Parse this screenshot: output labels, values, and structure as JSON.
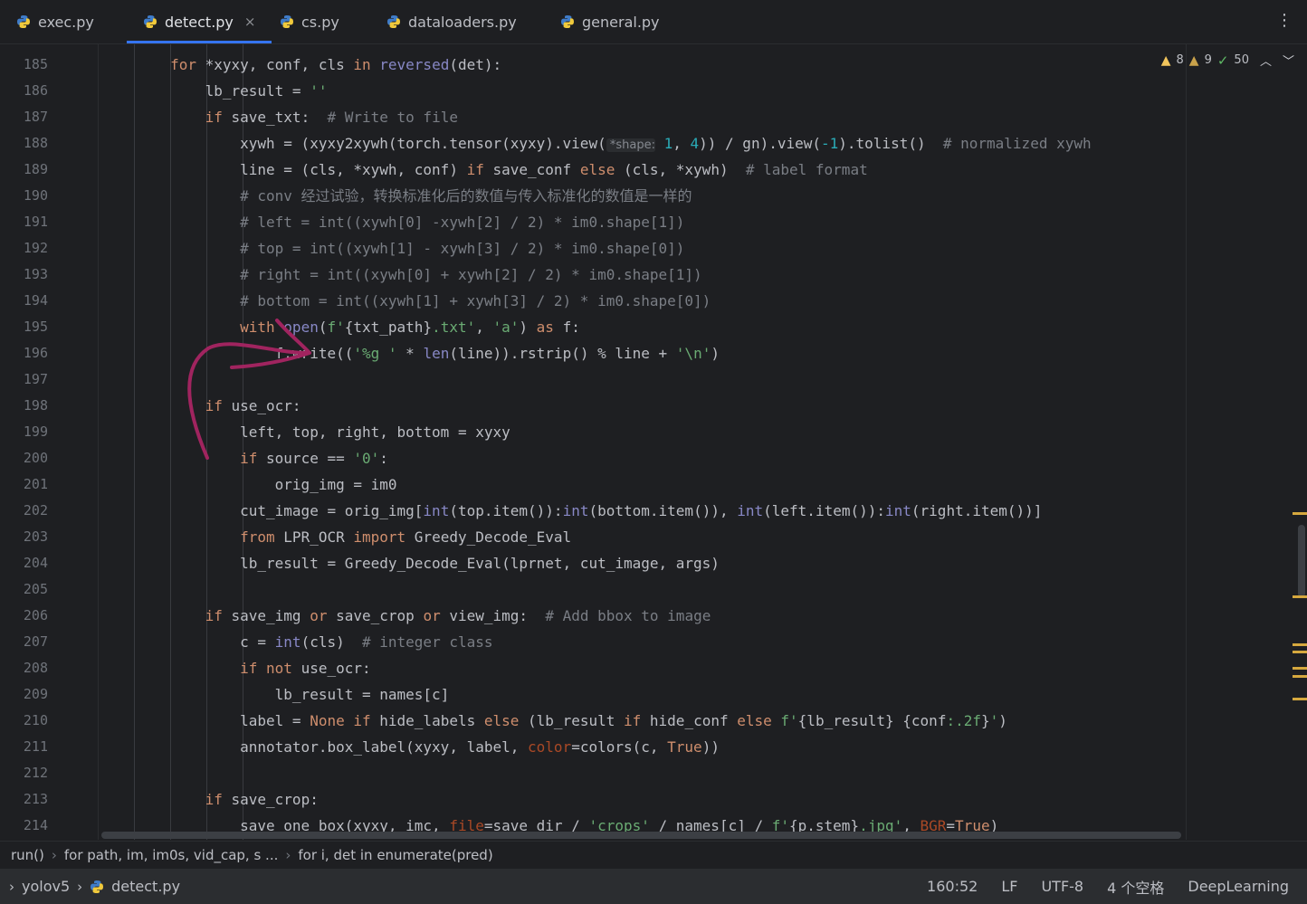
{
  "tabs": [
    {
      "label": "exec.py",
      "active": false,
      "icon": "python-icon"
    },
    {
      "label": "detect.py",
      "active": true,
      "icon": "python-icon",
      "close": "×"
    },
    {
      "label": "cs.py",
      "active": false,
      "icon": "python-icon"
    },
    {
      "label": "dataloaders.py",
      "active": false,
      "icon": "python-icon"
    },
    {
      "label": "general.py",
      "active": false,
      "icon": "python-icon"
    }
  ],
  "more_menu": "⋮",
  "inspections": {
    "warnings": "8",
    "weak_warnings": "9",
    "ok": "50"
  },
  "colors": {
    "keyword": "#cf8e6d",
    "builtin": "#8888c6",
    "string": "#6aab73",
    "comment": "#7a7e85",
    "number": "#2aacb8",
    "param": "#aa4926",
    "accent": "#3574f0",
    "arrow": "#a0245f"
  },
  "editor": {
    "line_numbers": [
      "185",
      "186",
      "187",
      "188",
      "189",
      "190",
      "191",
      "192",
      "193",
      "194",
      "195",
      "196",
      "197",
      "198",
      "199",
      "200",
      "201",
      "202",
      "203",
      "204",
      "205",
      "206",
      "207",
      "208",
      "209",
      "210",
      "211",
      "212",
      "213",
      "214"
    ],
    "lines": [
      [
        {
          "t": "        for ",
          "k": "kw"
        },
        {
          "t": "*xyxy, conf, cls "
        },
        {
          "t": "in ",
          "k": "kw"
        },
        {
          "t": "reversed",
          "k": "bi"
        },
        {
          "t": "(det):"
        }
      ],
      [
        {
          "t": "            lb_result = "
        },
        {
          "t": "''",
          "k": "str"
        }
      ],
      [
        {
          "t": "            if ",
          "k": "kw"
        },
        {
          "t": "save_txt:  "
        },
        {
          "t": "# Write to file",
          "k": "cm"
        }
      ],
      [
        {
          "t": "                xywh = (xyxy2xywh(torch.tensor(xyxy).view("
        },
        {
          "t": " *shape:",
          "k": "hint"
        },
        {
          "t": " "
        },
        {
          "t": "1",
          "k": "num"
        },
        {
          "t": ", "
        },
        {
          "t": "4",
          "k": "num"
        },
        {
          "t": ")) / gn).view("
        },
        {
          "t": "-1",
          "k": "num"
        },
        {
          "t": ").tolist()  "
        },
        {
          "t": "# normalized xywh",
          "k": "cm"
        }
      ],
      [
        {
          "t": "                line = (cls, *xywh, conf) "
        },
        {
          "t": "if ",
          "k": "kw"
        },
        {
          "t": "save_conf "
        },
        {
          "t": "else ",
          "k": "kw"
        },
        {
          "t": "(cls, *xywh)  "
        },
        {
          "t": "# label format",
          "k": "cm"
        }
      ],
      [
        {
          "t": "                # conv 经过试验，转换标准化后的数值与传入标准化的数值是一样的",
          "k": "cm"
        }
      ],
      [
        {
          "t": "                # left = int((xywh[0] -xywh[2] / 2) * im0.shape[1])",
          "k": "cm"
        }
      ],
      [
        {
          "t": "                # top = int((xywh[1] - xywh[3] / 2) * im0.shape[0])",
          "k": "cm"
        }
      ],
      [
        {
          "t": "                # right = int((xywh[0] + xywh[2] / 2) * im0.shape[1])",
          "k": "cm"
        }
      ],
      [
        {
          "t": "                # bottom = int((xywh[1] + xywh[3] / 2) * im0.shape[0])",
          "k": "cm"
        }
      ],
      [
        {
          "t": "                with ",
          "k": "kw"
        },
        {
          "t": "open",
          "k": "bi"
        },
        {
          "t": "("
        },
        {
          "t": "f'",
          "k": "str"
        },
        {
          "t": "{txt_path}"
        },
        {
          "t": ".txt'",
          "k": "str"
        },
        {
          "t": ", "
        },
        {
          "t": "'a'",
          "k": "str"
        },
        {
          "t": ") "
        },
        {
          "t": "as ",
          "k": "kw"
        },
        {
          "t": "f:"
        }
      ],
      [
        {
          "t": "                    f.write(("
        },
        {
          "t": "'%g '",
          "k": "str"
        },
        {
          "t": " * "
        },
        {
          "t": "len",
          "k": "bi"
        },
        {
          "t": "(line)).rstrip() % line + "
        },
        {
          "t": "'\\n'",
          "k": "str"
        },
        {
          "t": ")"
        }
      ],
      [
        {
          "t": ""
        }
      ],
      [
        {
          "t": "            if ",
          "k": "kw"
        },
        {
          "t": "use_ocr:"
        }
      ],
      [
        {
          "t": "                left, top, right, bottom = xyxy"
        }
      ],
      [
        {
          "t": "                if ",
          "k": "kw"
        },
        {
          "t": "source == "
        },
        {
          "t": "'0'",
          "k": "str"
        },
        {
          "t": ":"
        }
      ],
      [
        {
          "t": "                    orig_img = im0"
        }
      ],
      [
        {
          "t": "                cut_image = orig_img["
        },
        {
          "t": "int",
          "k": "bi"
        },
        {
          "t": "(top.item()):"
        },
        {
          "t": "int",
          "k": "bi"
        },
        {
          "t": "(bottom.item()), "
        },
        {
          "t": "int",
          "k": "bi"
        },
        {
          "t": "(left.item()):"
        },
        {
          "t": "int",
          "k": "bi"
        },
        {
          "t": "(right.item())]"
        }
      ],
      [
        {
          "t": "                from ",
          "k": "kw"
        },
        {
          "t": "LPR_OCR "
        },
        {
          "t": "import ",
          "k": "kw"
        },
        {
          "t": "Greedy_Decode_Eval"
        }
      ],
      [
        {
          "t": "                lb_result = Greedy_Decode_Eval(lprnet, cut_image, args)"
        }
      ],
      [
        {
          "t": ""
        }
      ],
      [
        {
          "t": "            if ",
          "k": "kw"
        },
        {
          "t": "save_img "
        },
        {
          "t": "or ",
          "k": "kw"
        },
        {
          "t": "save_crop "
        },
        {
          "t": "or ",
          "k": "kw"
        },
        {
          "t": "view_img:  "
        },
        {
          "t": "# Add bbox to image",
          "k": "cm"
        }
      ],
      [
        {
          "t": "                c = "
        },
        {
          "t": "int",
          "k": "bi"
        },
        {
          "t": "(cls)  "
        },
        {
          "t": "# integer class",
          "k": "cm"
        }
      ],
      [
        {
          "t": "                if not ",
          "k": "kw"
        },
        {
          "t": "use_ocr:"
        }
      ],
      [
        {
          "t": "                    lb_result = names[c]"
        }
      ],
      [
        {
          "t": "                label = "
        },
        {
          "t": "None ",
          "k": "kw"
        },
        {
          "t": "if ",
          "k": "kw"
        },
        {
          "t": "hide_labels "
        },
        {
          "t": "else ",
          "k": "kw"
        },
        {
          "t": "(lb_result "
        },
        {
          "t": "if ",
          "k": "kw"
        },
        {
          "t": "hide_conf "
        },
        {
          "t": "else ",
          "k": "kw"
        },
        {
          "t": "f'",
          "k": "str"
        },
        {
          "t": "{lb_result}"
        },
        {
          "t": " ",
          "k": "str"
        },
        {
          "t": "{conf"
        },
        {
          "t": ":.2f",
          "k": "str"
        },
        {
          "t": "}"
        },
        {
          "t": "'",
          "k": "str"
        },
        {
          "t": ")"
        }
      ],
      [
        {
          "t": "                annotator.box_label(xyxy, label, "
        },
        {
          "t": "color",
          "k": "param"
        },
        {
          "t": "=colors(c, "
        },
        {
          "t": "True",
          "k": "kw"
        },
        {
          "t": "))"
        }
      ],
      [
        {
          "t": ""
        }
      ],
      [
        {
          "t": "            if ",
          "k": "kw"
        },
        {
          "t": "save_crop:"
        }
      ],
      [
        {
          "t": "                save_one_box(xyxy, imc, "
        },
        {
          "t": "file",
          "k": "param"
        },
        {
          "t": "=save_dir / "
        },
        {
          "t": "'crops'",
          "k": "str"
        },
        {
          "t": " / names[c] / "
        },
        {
          "t": "f'",
          "k": "str"
        },
        {
          "t": "{p.stem}"
        },
        {
          "t": ".jpg'",
          "k": "str"
        },
        {
          "t": ", "
        },
        {
          "t": "BGR",
          "k": "param"
        },
        {
          "t": "="
        },
        {
          "t": "True",
          "k": "kw"
        },
        {
          "t": ")"
        }
      ]
    ]
  },
  "breadcrumb": [
    "run()",
    "for path, im, im0s, vid_cap, s ...",
    "for i, det in enumerate(pred)"
  ],
  "status": {
    "project": "yolov5",
    "file": "detect.py",
    "position": "160:52",
    "line_sep": "LF",
    "encoding": "UTF-8",
    "indent": "4 个空格",
    "interpreter": "DeepLearning"
  }
}
